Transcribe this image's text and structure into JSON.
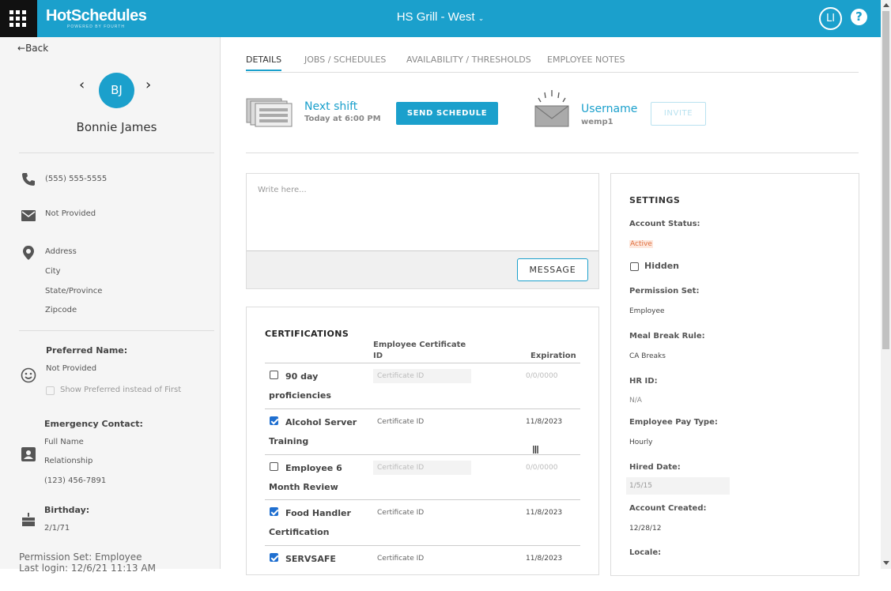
{
  "header": {
    "app_name": "HotSchedules",
    "app_tagline": "POWERED BY FOURTH",
    "store_name": "HS Grill - West",
    "user_initials": "LI",
    "help_label": "?"
  },
  "sidebar": {
    "back_label": "Back",
    "employee_initials": "BJ",
    "employee_name": "Bonnie James",
    "phone": "(555) 555-5555",
    "email": "Not Provided",
    "address": {
      "line1": "Address",
      "city": "City",
      "state": "State/Province",
      "zip": "Zipcode"
    },
    "preferred_name_label": "Preferred Name:",
    "preferred_name_value": "Not Provided",
    "show_preferred_label": "Show Preferred instead of First",
    "emergency_label": "Emergency Contact:",
    "emergency_name": "Full Name",
    "emergency_relationship": "Relationship",
    "emergency_phone": "(123) 456-7891",
    "birthday_label": "Birthday:",
    "birthday_value": "2/1/71",
    "permission_set_footer": "Permission Set: Employee",
    "last_login_footer": "Last login: 12/6/21 11:13 AM"
  },
  "tabs": [
    {
      "label": "DETAILS",
      "active": true
    },
    {
      "label": "JOBS / SCHEDULES",
      "active": false
    },
    {
      "label": "AVAILABILITY / THRESHOLDS",
      "active": false
    },
    {
      "label": "EMPLOYEE NOTES",
      "active": false
    }
  ],
  "shift": {
    "next_label": "Next shift",
    "next_value": "Today at 6:00 PM",
    "send_button": "SEND SCHEDULE",
    "username_label": "Username",
    "username_value": "wemp1",
    "invite_button": "INVITE"
  },
  "message": {
    "placeholder": "Write here...",
    "button": "MESSAGE"
  },
  "certifications": {
    "title": "CERTIFICATIONS",
    "col_id": "Employee Certificate ID",
    "col_exp": "Expiration",
    "rows": [
      {
        "name": "90 day proficiencies",
        "checked": false,
        "id": "Certificate ID",
        "expiration": "0/0/0000"
      },
      {
        "name": "Alcohol Server Training",
        "checked": true,
        "id": "Certificate ID",
        "expiration": "11/8/2023"
      },
      {
        "name": "Employee 6 Month Review",
        "checked": false,
        "id": "Certificate ID",
        "expiration": "0/0/0000"
      },
      {
        "name": "Food Handler Certification",
        "checked": true,
        "id": "Certificate ID",
        "expiration": "11/8/2023"
      },
      {
        "name": "SERVSAFE",
        "checked": true,
        "id": "Certificate ID",
        "expiration": "11/8/2023"
      }
    ]
  },
  "settings": {
    "title": "SETTINGS",
    "account_status_label": "Account Status:",
    "account_status_value": "Active",
    "hidden_label": "Hidden",
    "permission_set_label": "Permission Set:",
    "permission_set_value": "Employee",
    "meal_break_label": "Meal Break Rule:",
    "meal_break_value": "CA Breaks",
    "hr_id_label": "HR ID:",
    "hr_id_value": "N/A",
    "pay_type_label": "Employee Pay Type:",
    "pay_type_value": "Hourly",
    "hired_label": "Hired Date:",
    "hired_value": "1/5/15",
    "created_label": "Account Created:",
    "created_value": "12/28/12",
    "locale_label": "Locale:"
  }
}
